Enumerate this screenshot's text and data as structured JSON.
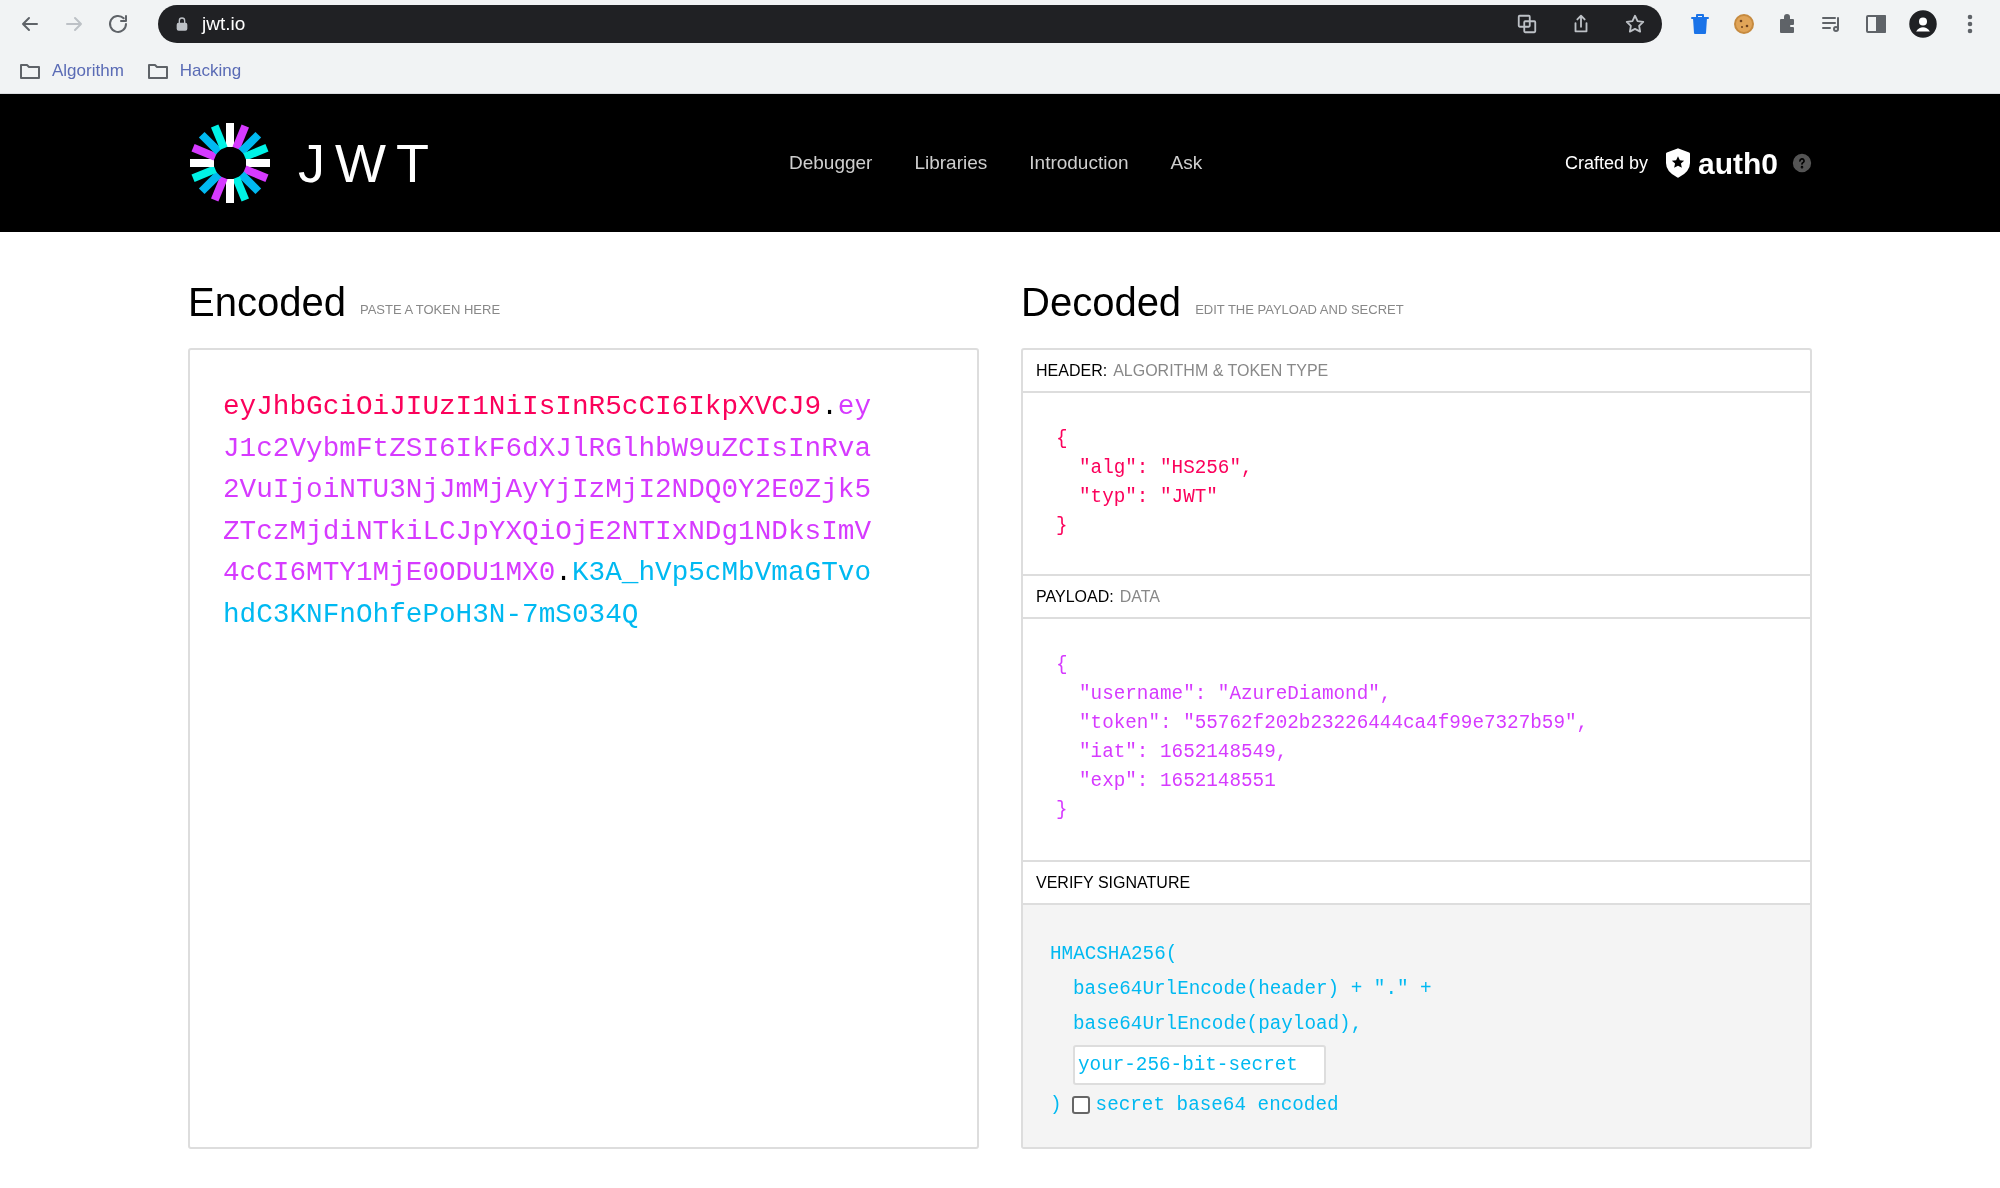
{
  "browser": {
    "url": "jwt.io",
    "bookmarks": [
      {
        "label": "Algorithm"
      },
      {
        "label": "Hacking"
      }
    ]
  },
  "site_header": {
    "logo_text": "JWT",
    "nav": [
      {
        "label": "Debugger"
      },
      {
        "label": "Libraries"
      },
      {
        "label": "Introduction"
      },
      {
        "label": "Ask"
      }
    ],
    "crafted_by": "Crafted by",
    "brand": "auth0"
  },
  "encoded": {
    "title": "Encoded",
    "subtitle": "PASTE A TOKEN HERE",
    "token_parts": [
      {
        "kind": "header",
        "text": "eyJhbGciOiJIUzI1NiIsInR5cCI6IkpXVCJ9"
      },
      {
        "kind": "dot",
        "text": "."
      },
      {
        "kind": "payload",
        "text": "eyJ1c2VybmFtZSI6IkF6dXJlRGlhbW9uZCIsInRva2VuIjoiNTU3NjJmMjAyYjIzMjI2NDQ0Y2E0Zjk5ZTczMjdiNTkiLCJpYXQiOjE2NTIxNDg1NDksImV4cCI6MTY1MjE0ODU1MX0"
      },
      {
        "kind": "dot",
        "text": "."
      },
      {
        "kind": "signature",
        "text": "K3A_hVp5cMbVmaGTvohdC3KNFnOhfePoH3N-7mS034Q"
      }
    ]
  },
  "decoded": {
    "title": "Decoded",
    "subtitle": "EDIT THE PAYLOAD AND SECRET",
    "sections": [
      {
        "kind": "header",
        "label": "HEADER:",
        "sublabel": "ALGORITHM & TOKEN TYPE",
        "code": {
          "open": "{",
          "children": [
            "\"alg\": \"HS256\",",
            "\"typ\": \"JWT\""
          ],
          "close": "}"
        }
      },
      {
        "kind": "payload",
        "label": "PAYLOAD:",
        "sublabel": "DATA",
        "code": {
          "open": "{",
          "children": [
            "\"username\": \"AzureDiamond\",",
            "\"token\": \"55762f202b23226444ca4f99e7327b59\",",
            "\"iat\": 1652148549,",
            "\"exp\": 1652148551"
          ],
          "close": "}"
        }
      }
    ],
    "verify": {
      "label": "VERIFY SIGNATURE",
      "open": "HMACSHA256(",
      "children": [
        "base64UrlEncode(header) + \".\" +",
        "base64UrlEncode(payload),"
      ],
      "secret_placeholder": "your-256-bit-secret",
      "close": ")",
      "checkbox_label": "secret base64 encoded",
      "checked": false
    }
  }
}
